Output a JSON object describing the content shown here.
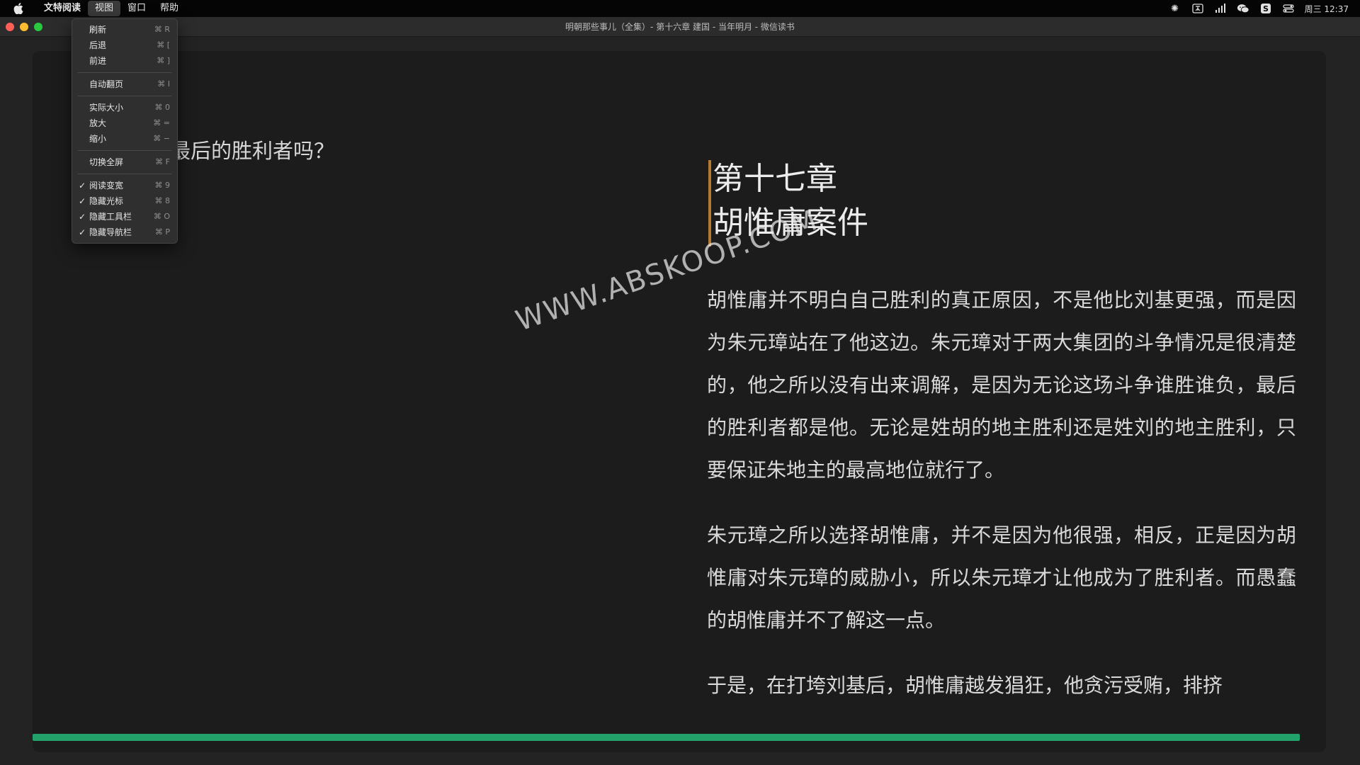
{
  "menubar": {
    "app_name": "文特阅读",
    "menus": [
      "视图",
      "窗口",
      "帮助"
    ],
    "clock": "周三 12:37"
  },
  "window": {
    "title": "明朝那些事儿（全集）- 第十六章 建国 - 当年明月 - 微信读书"
  },
  "view_menu": {
    "items": [
      {
        "label": "刷新",
        "shortcut": "⌘ R",
        "checked": false
      },
      {
        "label": "后退",
        "shortcut": "⌘ [",
        "checked": false
      },
      {
        "label": "前进",
        "shortcut": "⌘ ]",
        "checked": false
      },
      {
        "label": "自动翻页",
        "shortcut": "⌘ I",
        "checked": false
      },
      {
        "label": "实际大小",
        "shortcut": "⌘ 0",
        "checked": false
      },
      {
        "label": "放大",
        "shortcut": "⌘ =",
        "checked": false
      },
      {
        "label": "缩小",
        "shortcut": "⌘ −",
        "checked": false
      },
      {
        "label": "切换全屏",
        "shortcut": "⌘ F",
        "checked": false
      },
      {
        "label": "阅读变宽",
        "shortcut": "⌘ 9",
        "checked": true
      },
      {
        "label": "隐藏光标",
        "shortcut": "⌘ 8",
        "checked": true
      },
      {
        "label": "隐藏工具栏",
        "shortcut": "⌘ O",
        "checked": true
      },
      {
        "label": "隐藏导航栏",
        "shortcut": "⌘ P",
        "checked": true
      }
    ],
    "check_mark": "✓"
  },
  "reader": {
    "left_page_text": "最后的胜利者吗？",
    "chapter_number": "第十七章",
    "chapter_name": "胡惟庸案件",
    "paragraphs": [
      "胡惟庸并不明白自己胜利的真正原因，不是他比刘基更强，而是因为朱元璋站在了他这边。朱元璋对于两大集团的斗争情况是很清楚的，他之所以没有出来调解，是因为无论这场斗争谁胜谁负，最后的胜利者都是他。无论是姓胡的地主胜利还是姓刘的地主胜利，只要保证朱地主的最高地位就行了。",
      "朱元璋之所以选择胡惟庸，并不是因为他很强，相反，正是因为胡惟庸对朱元璋的威胁小，所以朱元璋才让他成为了胜利者。而愚蠢的胡惟庸并不了解这一点。",
      "于是，在打垮刘基后，胡惟庸越发猖狂，他贪污受贿，排挤"
    ],
    "watermark": "WWW.ABSKOOP.COM",
    "progress_percent": 98,
    "progress_color": "#23a36b"
  }
}
